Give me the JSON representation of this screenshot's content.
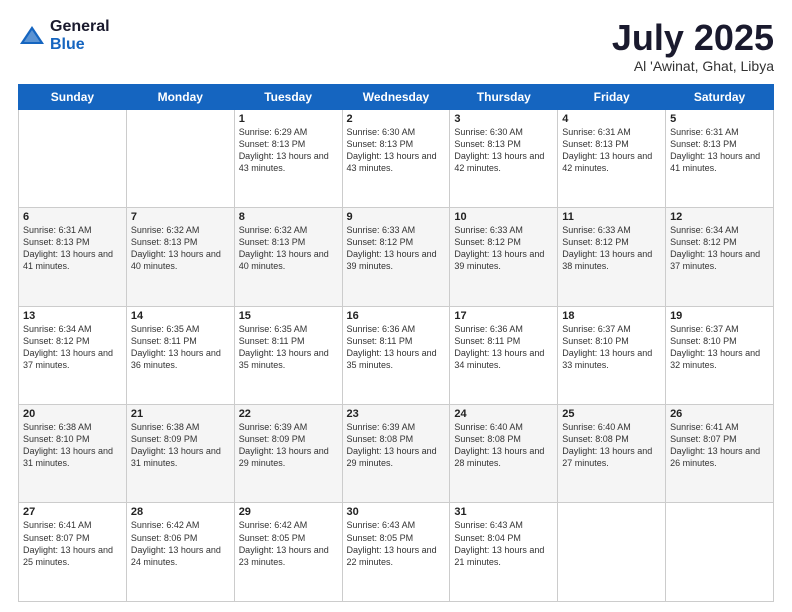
{
  "header": {
    "logo_general": "General",
    "logo_blue": "Blue",
    "title": "July 2025",
    "location": "Al 'Awinat, Ghat, Libya"
  },
  "days_of_week": [
    "Sunday",
    "Monday",
    "Tuesday",
    "Wednesday",
    "Thursday",
    "Friday",
    "Saturday"
  ],
  "weeks": [
    [
      {
        "day": "",
        "info": ""
      },
      {
        "day": "",
        "info": ""
      },
      {
        "day": "1",
        "info": "Sunrise: 6:29 AM\nSunset: 8:13 PM\nDaylight: 13 hours and 43 minutes."
      },
      {
        "day": "2",
        "info": "Sunrise: 6:30 AM\nSunset: 8:13 PM\nDaylight: 13 hours and 43 minutes."
      },
      {
        "day": "3",
        "info": "Sunrise: 6:30 AM\nSunset: 8:13 PM\nDaylight: 13 hours and 42 minutes."
      },
      {
        "day": "4",
        "info": "Sunrise: 6:31 AM\nSunset: 8:13 PM\nDaylight: 13 hours and 42 minutes."
      },
      {
        "day": "5",
        "info": "Sunrise: 6:31 AM\nSunset: 8:13 PM\nDaylight: 13 hours and 41 minutes."
      }
    ],
    [
      {
        "day": "6",
        "info": "Sunrise: 6:31 AM\nSunset: 8:13 PM\nDaylight: 13 hours and 41 minutes."
      },
      {
        "day": "7",
        "info": "Sunrise: 6:32 AM\nSunset: 8:13 PM\nDaylight: 13 hours and 40 minutes."
      },
      {
        "day": "8",
        "info": "Sunrise: 6:32 AM\nSunset: 8:13 PM\nDaylight: 13 hours and 40 minutes."
      },
      {
        "day": "9",
        "info": "Sunrise: 6:33 AM\nSunset: 8:12 PM\nDaylight: 13 hours and 39 minutes."
      },
      {
        "day": "10",
        "info": "Sunrise: 6:33 AM\nSunset: 8:12 PM\nDaylight: 13 hours and 39 minutes."
      },
      {
        "day": "11",
        "info": "Sunrise: 6:33 AM\nSunset: 8:12 PM\nDaylight: 13 hours and 38 minutes."
      },
      {
        "day": "12",
        "info": "Sunrise: 6:34 AM\nSunset: 8:12 PM\nDaylight: 13 hours and 37 minutes."
      }
    ],
    [
      {
        "day": "13",
        "info": "Sunrise: 6:34 AM\nSunset: 8:12 PM\nDaylight: 13 hours and 37 minutes."
      },
      {
        "day": "14",
        "info": "Sunrise: 6:35 AM\nSunset: 8:11 PM\nDaylight: 13 hours and 36 minutes."
      },
      {
        "day": "15",
        "info": "Sunrise: 6:35 AM\nSunset: 8:11 PM\nDaylight: 13 hours and 35 minutes."
      },
      {
        "day": "16",
        "info": "Sunrise: 6:36 AM\nSunset: 8:11 PM\nDaylight: 13 hours and 35 minutes."
      },
      {
        "day": "17",
        "info": "Sunrise: 6:36 AM\nSunset: 8:11 PM\nDaylight: 13 hours and 34 minutes."
      },
      {
        "day": "18",
        "info": "Sunrise: 6:37 AM\nSunset: 8:10 PM\nDaylight: 13 hours and 33 minutes."
      },
      {
        "day": "19",
        "info": "Sunrise: 6:37 AM\nSunset: 8:10 PM\nDaylight: 13 hours and 32 minutes."
      }
    ],
    [
      {
        "day": "20",
        "info": "Sunrise: 6:38 AM\nSunset: 8:10 PM\nDaylight: 13 hours and 31 minutes."
      },
      {
        "day": "21",
        "info": "Sunrise: 6:38 AM\nSunset: 8:09 PM\nDaylight: 13 hours and 31 minutes."
      },
      {
        "day": "22",
        "info": "Sunrise: 6:39 AM\nSunset: 8:09 PM\nDaylight: 13 hours and 29 minutes."
      },
      {
        "day": "23",
        "info": "Sunrise: 6:39 AM\nSunset: 8:08 PM\nDaylight: 13 hours and 29 minutes."
      },
      {
        "day": "24",
        "info": "Sunrise: 6:40 AM\nSunset: 8:08 PM\nDaylight: 13 hours and 28 minutes."
      },
      {
        "day": "25",
        "info": "Sunrise: 6:40 AM\nSunset: 8:08 PM\nDaylight: 13 hours and 27 minutes."
      },
      {
        "day": "26",
        "info": "Sunrise: 6:41 AM\nSunset: 8:07 PM\nDaylight: 13 hours and 26 minutes."
      }
    ],
    [
      {
        "day": "27",
        "info": "Sunrise: 6:41 AM\nSunset: 8:07 PM\nDaylight: 13 hours and 25 minutes."
      },
      {
        "day": "28",
        "info": "Sunrise: 6:42 AM\nSunset: 8:06 PM\nDaylight: 13 hours and 24 minutes."
      },
      {
        "day": "29",
        "info": "Sunrise: 6:42 AM\nSunset: 8:05 PM\nDaylight: 13 hours and 23 minutes."
      },
      {
        "day": "30",
        "info": "Sunrise: 6:43 AM\nSunset: 8:05 PM\nDaylight: 13 hours and 22 minutes."
      },
      {
        "day": "31",
        "info": "Sunrise: 6:43 AM\nSunset: 8:04 PM\nDaylight: 13 hours and 21 minutes."
      },
      {
        "day": "",
        "info": ""
      },
      {
        "day": "",
        "info": ""
      }
    ]
  ]
}
